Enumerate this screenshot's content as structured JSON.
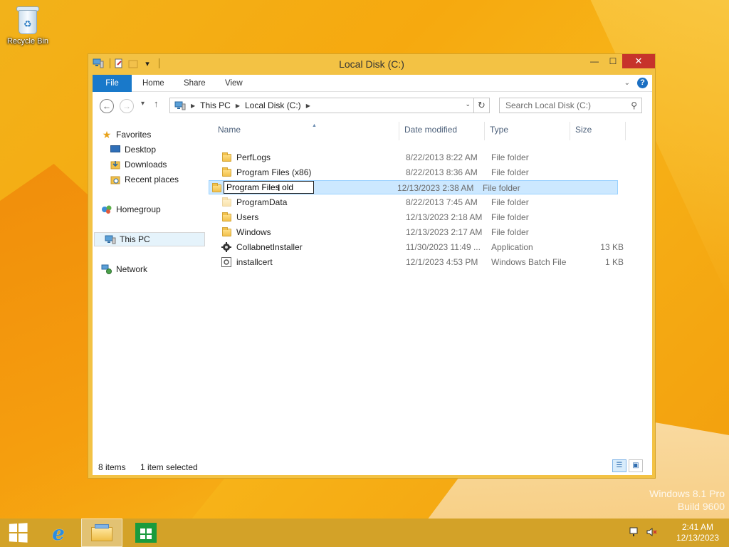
{
  "desktop": {
    "recycle_bin_label": "Recycle Bin",
    "watermark_line1": "Windows 8.1 Pro",
    "watermark_line2": "Build 9600"
  },
  "window": {
    "title": "Local Disk (C:)",
    "ribbon_tabs": [
      "File",
      "Home",
      "Share",
      "View"
    ],
    "address": {
      "segments": [
        "This PC",
        "Local Disk (C:)"
      ]
    },
    "search_placeholder": "Search Local Disk (C:)",
    "nav": {
      "favorites": "Favorites",
      "desktop": "Desktop",
      "downloads": "Downloads",
      "recent_places": "Recent places",
      "homegroup": "Homegroup",
      "this_pc": "This PC",
      "network": "Network"
    },
    "columns": {
      "name": "Name",
      "date_modified": "Date modified",
      "type": "Type",
      "size": "Size"
    },
    "files": [
      {
        "name": "PerfLogs",
        "date": "8/22/2013 8:22 AM",
        "type": "File folder",
        "size": ""
      },
      {
        "name": "Program Files (x86)",
        "date": "8/22/2013 8:36 AM",
        "type": "File folder",
        "size": ""
      },
      {
        "name": "Program Files old",
        "date": "12/13/2023 2:38 AM",
        "type": "File folder",
        "size": ""
      },
      {
        "name": "ProgramData",
        "date": "8/22/2013 7:45 AM",
        "type": "File folder",
        "size": ""
      },
      {
        "name": "Users",
        "date": "12/13/2023 2:18 AM",
        "type": "File folder",
        "size": ""
      },
      {
        "name": "Windows",
        "date": "12/13/2023 2:17 AM",
        "type": "File folder",
        "size": ""
      },
      {
        "name": "CollabnetInstaller",
        "date": "11/30/2023 11:49 ...",
        "type": "Application",
        "size": "13 KB"
      },
      {
        "name": "installcert",
        "date": "12/1/2023 4:53 PM",
        "type": "Windows Batch File",
        "size": "1 KB"
      }
    ],
    "status": {
      "items": "8 items",
      "selected": "1 item selected"
    }
  },
  "taskbar": {
    "time": "2:41 AM",
    "date": "12/13/2023"
  },
  "colors": {
    "accent": "#1979ca",
    "taskbar": "#d3a228",
    "selection": "#cce8ff",
    "close_button": "#c7332b"
  }
}
